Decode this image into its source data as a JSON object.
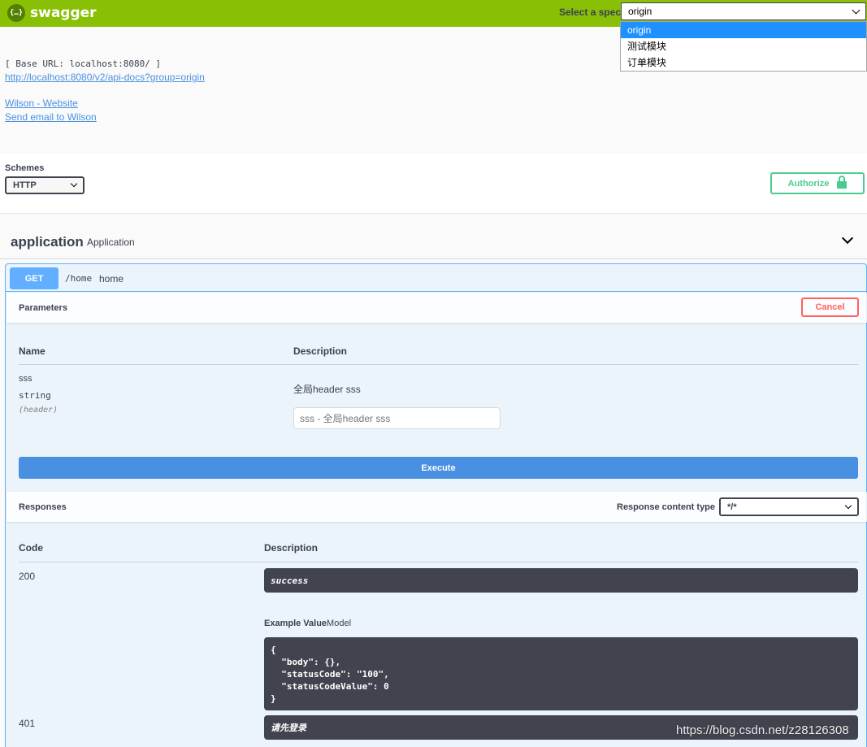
{
  "topbar": {
    "logo_mark": "{…}",
    "logo_text": "swagger",
    "spec_label": "Select a spec",
    "spec_selected": "origin",
    "spec_options": [
      "origin",
      "测试模块",
      "订单模块"
    ]
  },
  "info": {
    "base_url": "[ Base URL: localhost:8080/ ]",
    "api_docs_link": "http://localhost:8080/v2/api-docs?group=origin",
    "website_link": "Wilson - Website",
    "email_link": "Send email to Wilson"
  },
  "schemes": {
    "title": "Schemes",
    "selected": "HTTP",
    "authorize_label": "Authorize"
  },
  "tag": {
    "name": "application",
    "description": "Application"
  },
  "operation": {
    "method": "GET",
    "path": "/home",
    "summary": "home",
    "parameters_title": "Parameters",
    "cancel_label": "Cancel",
    "col_name": "Name",
    "col_description": "Description",
    "param": {
      "name": "sss",
      "type": "string",
      "in": "(header)",
      "description": "全局header sss",
      "placeholder": "sss - 全局header sss"
    },
    "execute_label": "Execute"
  },
  "responses": {
    "title": "Responses",
    "content_type_label": "Response content type",
    "content_type_value": "*/*",
    "col_code": "Code",
    "col_description": "Description",
    "items": [
      {
        "code": "200",
        "description": "success"
      },
      {
        "code": "401",
        "description": "请先登录"
      }
    ],
    "example_value_tab": "Example Value",
    "model_tab": "Model",
    "example_json": "{\n  \"body\": {},\n  \"statusCode\": \"100\",\n  \"statusCodeValue\": 0\n}"
  },
  "watermark": "https://blog.csdn.net/z28126308"
}
